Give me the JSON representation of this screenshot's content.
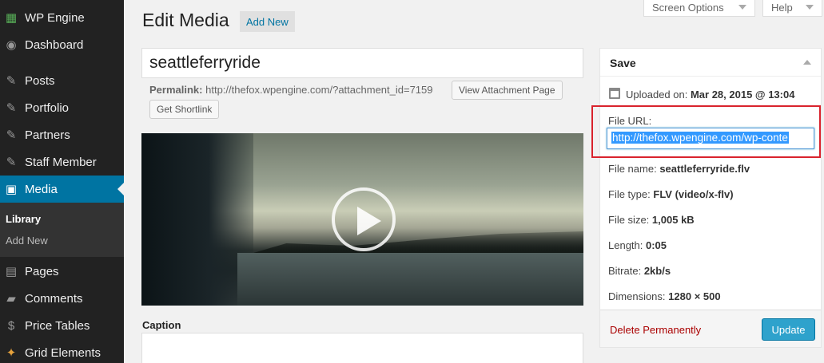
{
  "sidebar": {
    "items": [
      {
        "label": "WP Engine",
        "icon": "wp-engine-icon",
        "glyph": "▦"
      },
      {
        "label": "Dashboard",
        "icon": "dashboard-icon",
        "glyph": "◉"
      },
      {
        "label": "Posts",
        "icon": "pushpin-icon",
        "glyph": "✎"
      },
      {
        "label": "Portfolio",
        "icon": "pushpin-icon",
        "glyph": "✎"
      },
      {
        "label": "Partners",
        "icon": "pushpin-icon",
        "glyph": "✎"
      },
      {
        "label": "Staff Member",
        "icon": "pushpin-icon",
        "glyph": "✎"
      },
      {
        "label": "Media",
        "icon": "media-icon",
        "glyph": "▣"
      },
      {
        "label": "Pages",
        "icon": "pages-icon",
        "glyph": "▤"
      },
      {
        "label": "Comments",
        "icon": "comments-icon",
        "glyph": "▰"
      },
      {
        "label": "Price Tables",
        "icon": "dollar-icon",
        "glyph": "$"
      },
      {
        "label": "Grid Elements",
        "icon": "grid-elements-icon",
        "glyph": "✦"
      }
    ],
    "submenu": [
      {
        "label": "Library"
      },
      {
        "label": "Add New"
      }
    ]
  },
  "top_buttons": {
    "screen_options": "Screen Options",
    "help": "Help"
  },
  "header": {
    "title": "Edit Media",
    "add_new": "Add New"
  },
  "editor": {
    "title_value": "seattleferryride",
    "permalink_label": "Permalink:",
    "permalink_url": "http://thefox.wpengine.com/?attachment_id=7159",
    "view_attachment": "View Attachment Page",
    "get_shortlink": "Get Shortlink",
    "caption_label": "Caption"
  },
  "save_box": {
    "title": "Save",
    "uploaded_label": "Uploaded on:",
    "uploaded_value": "Mar 28, 2015 @ 13:04",
    "file_url_label": "File URL:",
    "file_url_value": "http://thefox.wpengine.com/wp-conte",
    "file_name_label": "File name:",
    "file_name_value": "seattleferryride.flv",
    "file_type_label": "File type:",
    "file_type_value": "FLV (video/x-flv)",
    "file_size_label": "File size:",
    "file_size_value": "1,005 kB",
    "length_label": "Length:",
    "length_value": "0:05",
    "bitrate_label": "Bitrate:",
    "bitrate_value": "2kb/s",
    "dimensions_label": "Dimensions:",
    "dimensions_value": "1280 × 500",
    "delete": "Delete Permanently",
    "update": "Update"
  },
  "colors": {
    "sidebar_bg": "#222222",
    "active_bg": "#0074a2",
    "primary_button": "#2ea2cc",
    "delete_link": "#aa0000",
    "highlight_border": "#d9232d"
  }
}
